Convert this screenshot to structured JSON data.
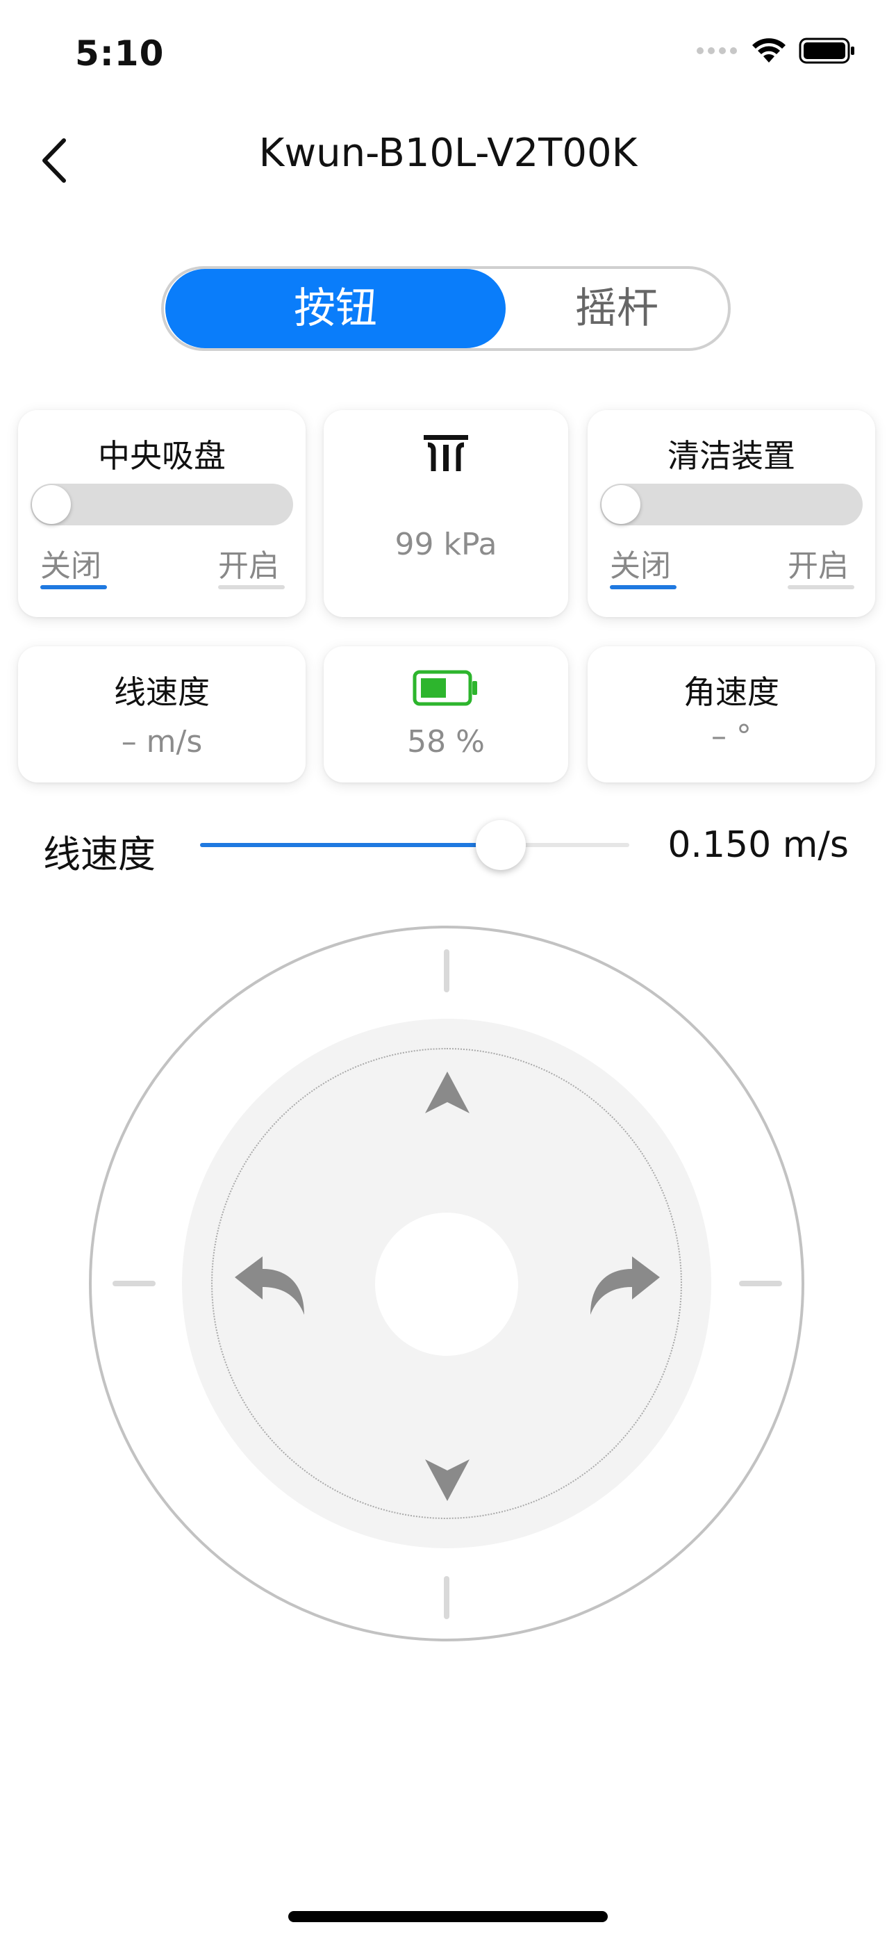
{
  "status_bar": {
    "time": "5:10"
  },
  "nav": {
    "title": "Kwun-B10L-V2T00K"
  },
  "segmented": {
    "active": "按钮",
    "inactive": "摇杆"
  },
  "cards": {
    "suction": {
      "title": "中央吸盘",
      "off": "关闭",
      "on": "开启"
    },
    "pressure": {
      "icon": "pressure-gauge-icon",
      "value": "99 kPa"
    },
    "cleaning": {
      "title": "清洁装置",
      "off": "关闭",
      "on": "开启"
    },
    "linear_speed": {
      "title": "线速度",
      "value": "– m/s"
    },
    "battery": {
      "icon": "battery-icon",
      "value": "58 %",
      "level": 0.58
    },
    "angular_speed": {
      "title": "角速度",
      "value": "– °"
    }
  },
  "slider": {
    "label": "线速度",
    "value": "0.150 m/s",
    "fraction": 0.7
  },
  "colors": {
    "accent": "#0a7dfa",
    "battery": "#2db52d",
    "arrow": "#8a8a8a"
  }
}
